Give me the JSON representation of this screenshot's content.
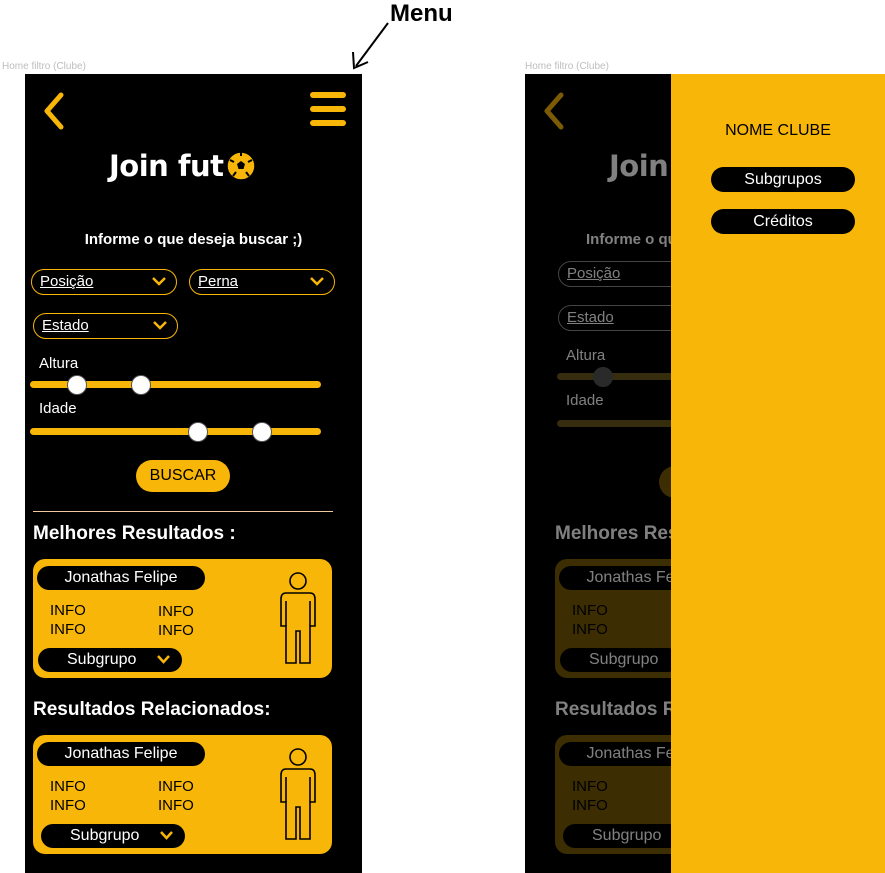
{
  "annotation": {
    "label": "Menu"
  },
  "frames": [
    {
      "label": "Home filtro (Clube)"
    },
    {
      "label": "Home filtro (Clube)"
    }
  ],
  "app": {
    "logo_text": "Join fut"
  },
  "filter": {
    "prompt": "Informe o que deseja buscar ;)",
    "posicao": "Posição",
    "perna": "Perna",
    "estado": "Estado",
    "altura_label": "Altura",
    "idade_label": "Idade",
    "buscar": "BUSCAR"
  },
  "sections": {
    "best": "Melhores Resultados :",
    "related": "Resultados Relacionados:"
  },
  "cards": [
    {
      "name": "Jonathas Felipe",
      "info": [
        "INFO",
        "INFO",
        "INFO",
        "INFO"
      ],
      "subgroup": "Subgrupo"
    },
    {
      "name": "Jonathas Felipe",
      "info": [
        "INFO",
        "INFO",
        "INFO",
        "INFO"
      ],
      "subgroup": "Subgrupo"
    }
  ],
  "drawer": {
    "title": "NOME CLUBE",
    "items": [
      "Subgrupos",
      "Créditos"
    ]
  },
  "colors": {
    "accent": "#f8b608",
    "background": "#000000"
  },
  "icons": [
    "back-chevron-icon",
    "menu-hamburger-icon",
    "soccer-ball-icon",
    "chevron-down-icon",
    "person-outline-icon"
  ]
}
